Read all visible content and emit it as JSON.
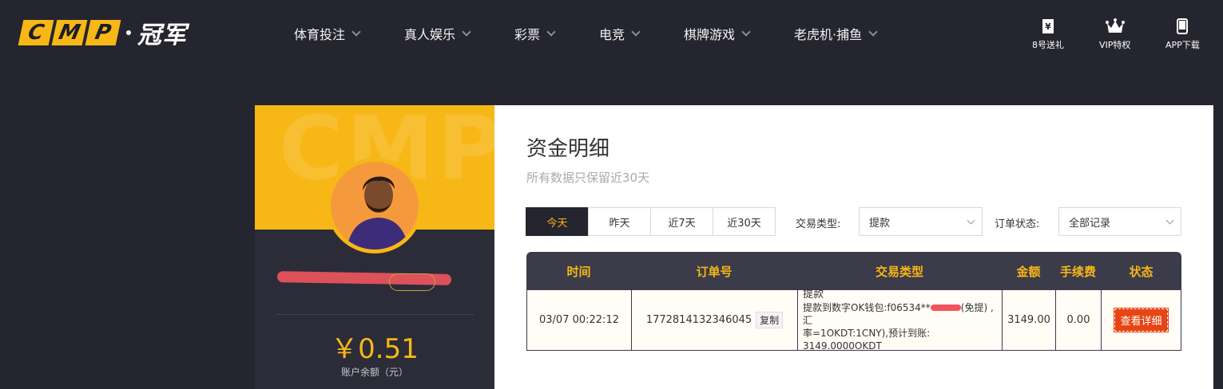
{
  "header": {
    "logo_text": "CMP",
    "logo_cn": "冠军",
    "nav": [
      {
        "label": "体育投注"
      },
      {
        "label": "真人娱乐"
      },
      {
        "label": "彩票"
      },
      {
        "label": "电竞"
      },
      {
        "label": "棋牌游戏"
      },
      {
        "label": "老虎机·捕鱼"
      }
    ],
    "utils": [
      {
        "label": "8号送礼",
        "icon": "gift-ticket-icon"
      },
      {
        "label": "VIP特权",
        "icon": "crown-icon"
      },
      {
        "label": "APP下载",
        "icon": "phone-icon"
      }
    ]
  },
  "profile": {
    "banner_watermark": "CMP",
    "balance": "￥0.51",
    "balance_label": "账户余额（元）"
  },
  "main": {
    "title": "资金明细",
    "subtitle": "所有数据只保留近30天",
    "tabs": [
      {
        "label": "今天",
        "active": true
      },
      {
        "label": "昨天"
      },
      {
        "label": "近7天"
      },
      {
        "label": "近30天"
      }
    ],
    "filters": {
      "type_label": "交易类型:",
      "type_value": "提款",
      "status_label": "订单状态:",
      "status_value": "全部记录"
    },
    "table": {
      "headers": [
        "时间",
        "订单号",
        "交易类型",
        "金额",
        "手续费",
        "状态"
      ],
      "rows": [
        {
          "time": "03/07 00:22:12",
          "order_no": "1772814132346045",
          "copy_label": "复制",
          "type_title": "提款",
          "type_line1a": "提款到数字OK钱包:f06534**",
          "type_line1b": "(免提) ,汇",
          "type_line2": "率=1OKDT:1CNY),预计到账:",
          "type_line3": "3149.0000OKDT",
          "amount": "3149.00",
          "fee": "0.00",
          "status_button": "查看详细"
        }
      ]
    }
  },
  "colors": {
    "accent": "#f7b716",
    "header_bg": "#25252f",
    "table_head": "#3b3b4a",
    "detail_button": "#e74513"
  }
}
